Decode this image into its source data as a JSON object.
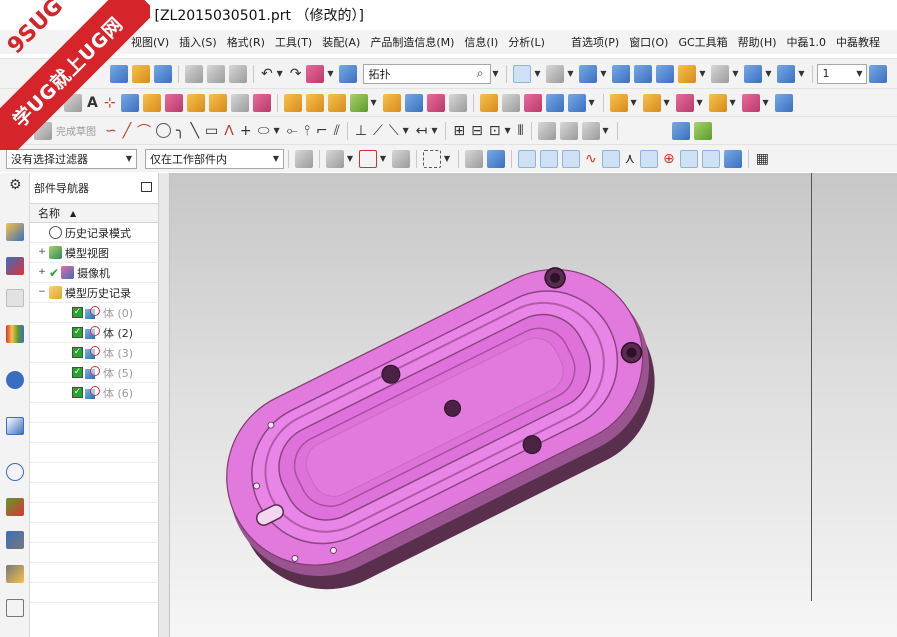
{
  "window": {
    "title": "- [ZL2015030501.prt （修改的）]"
  },
  "watermark": {
    "brand": "9SUG",
    "slogan": "学UG就上UG网"
  },
  "menu": {
    "items": [
      "视图(V)",
      "插入(S)",
      "格式(R)",
      "工具(T)",
      "装配(A)",
      "产品制造信息(M)",
      "信息(I)",
      "分析(L)",
      "首选项(P)",
      "窗口(O)",
      "GC工具箱",
      "帮助(H)",
      "中磊1.0",
      "中磊教程"
    ]
  },
  "toolbar": {
    "search_value": "拓扑",
    "layer_value": "1",
    "sketch_finish_label": "完成草图",
    "selection_filter_value": "没有选择过滤器",
    "scope_value": "仅在工作部件内"
  },
  "navigator": {
    "title": "部件导航器",
    "column_header": "名称",
    "nodes": [
      {
        "label": "历史记录模式"
      },
      {
        "label": "模型视图"
      },
      {
        "label": "摄像机"
      },
      {
        "label": "模型历史记录"
      }
    ],
    "bodies": [
      {
        "label": "体 (0)",
        "state": "suppressed"
      },
      {
        "label": "体 (2)",
        "state": "active"
      },
      {
        "label": "体 (3)",
        "state": "suppressed"
      },
      {
        "label": "体 (5)",
        "state": "suppressed"
      },
      {
        "label": "体 (6)",
        "state": "suppressed"
      }
    ]
  },
  "colors": {
    "model_face": "#e27ade",
    "model_side": "#7e3b6f",
    "graphics_bg_top": "#c7c7c7",
    "graphics_bg_bottom": "#f6f6f6",
    "badge_red": "#d6242b"
  }
}
